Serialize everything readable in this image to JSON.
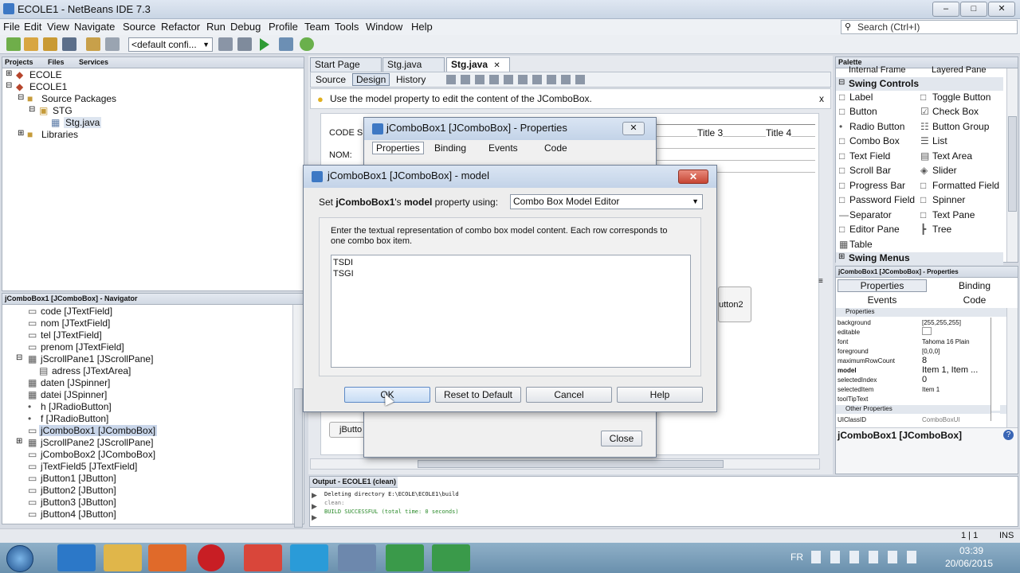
{
  "window": {
    "title": "ECOLE1 - NetBeans IDE 7.3"
  },
  "menu": [
    "File",
    "Edit",
    "View",
    "Navigate",
    "Source",
    "Refactor",
    "Run",
    "Debug",
    "Profile",
    "Team",
    "Tools",
    "Window",
    "Help"
  ],
  "search": {
    "placeholder": "Search (Ctrl+I)"
  },
  "toolbar": {
    "config": "<default confi..."
  },
  "projects": {
    "tabs": [
      "Projects",
      "Files",
      "Services"
    ],
    "tree": [
      "ECOLE",
      "ECOLE1",
      "Source Packages",
      "STG",
      "Stg.java",
      "Libraries"
    ]
  },
  "navigator": {
    "title": "jComboBox1 [JComboBox] - Navigator",
    "items": [
      "code [JTextField]",
      "nom [JTextField]",
      "tel [JTextField]",
      "prenom [JTextField]",
      "jScrollPane1 [JScrollPane]",
      "adress [JTextArea]",
      "daten [JSpinner]",
      "datei [JSpinner]",
      "h [JRadioButton]",
      "f [JRadioButton]",
      "jComboBox1 [JComboBox]",
      "jScrollPane2 [JScrollPane]",
      "jComboBox2 [JComboBox]",
      "jTextField5 [JTextField]",
      "jButton1 [JButton]",
      "jButton2 [JButton]",
      "jButton3 [JButton]",
      "jButton4 [JButton]"
    ]
  },
  "editor": {
    "tabs": [
      "Start Page",
      "Stg.java",
      "Stg.java"
    ],
    "subtabs": [
      "Source",
      "Design",
      "History"
    ],
    "hint": "Use the model property to edit the content of the JComboBox.",
    "form": {
      "code": "CODE S",
      "nom": "NOM:",
      "title3": "Title 3",
      "title4": "Title 4",
      "button2": "utton2",
      "jbutton": "jButto"
    }
  },
  "props_dialog": {
    "title": "jComboBox1 [JComboBox] - Properties",
    "tabs": [
      "Properties",
      "Binding",
      "Events",
      "Code"
    ],
    "close": "Close"
  },
  "model_dialog": {
    "title": "jComboBox1 [JComboBox] - model",
    "set_prefix": "Set ",
    "set_bold1": "jComboBox1",
    "set_mid": "'s ",
    "set_bold2": "model",
    "set_suffix": " property using:",
    "editor_select": "Combo Box Model Editor",
    "instructions": "Enter the textual representation of combo box model content. Each row corresponds to one combo box item.",
    "content": "TSDI\nTSGI",
    "buttons": {
      "ok": "OK",
      "reset": "Reset to Default",
      "cancel": "Cancel",
      "help": "Help"
    }
  },
  "palette": {
    "title": "Palette",
    "top_items": [
      "Internal Frame",
      "Layered Pane"
    ],
    "category": "Swing Controls",
    "left": [
      "Label",
      "Button",
      "Radio Button",
      "Combo Box",
      "Text Field",
      "Scroll Bar",
      "Progress Bar",
      "Password Field",
      "Separator",
      "Editor Pane",
      "Table"
    ],
    "right": [
      "Toggle Button",
      "Check Box",
      "Button Group",
      "List",
      "Text Area",
      "Slider",
      "Formatted Field",
      "Spinner",
      "Text Pane",
      "Tree"
    ],
    "category2": "Swing Menus"
  },
  "properties": {
    "title": "jComboBox1 [JComboBox] - Properties",
    "tabs": [
      "Properties",
      "Binding",
      "Events",
      "Code"
    ],
    "section": "Properties",
    "rows": [
      [
        "background",
        "[255,255,255]"
      ],
      [
        "editable",
        ""
      ],
      [
        "font",
        "Tahoma 16 Plain"
      ],
      [
        "foreground",
        "[0,0,0]"
      ],
      [
        "maximumRowCount",
        "8"
      ],
      [
        "model",
        "Item 1, Item ..."
      ],
      [
        "selectedIndex",
        "0"
      ],
      [
        "selectedItem",
        "Item 1"
      ],
      [
        "toolTipText",
        ""
      ]
    ],
    "section2": "Other Properties",
    "rows2": [
      [
        "UIClassID",
        "ComboBoxUI"
      ]
    ],
    "footer": "jComboBox1 [JComboBox]"
  },
  "output": {
    "title": "Output - ECOLE1 (clean)",
    "lines": [
      "Deleting directory E:\\ECOLE\\ECOLE1\\build",
      "clean:",
      "BUILD SUCCESSFUL (total time: 0 seconds)"
    ]
  },
  "status": {
    "pos": "1 | 1",
    "mode": "INS"
  },
  "tray": {
    "lang": "FR",
    "time": "03:39",
    "date": "20/06/2015"
  }
}
